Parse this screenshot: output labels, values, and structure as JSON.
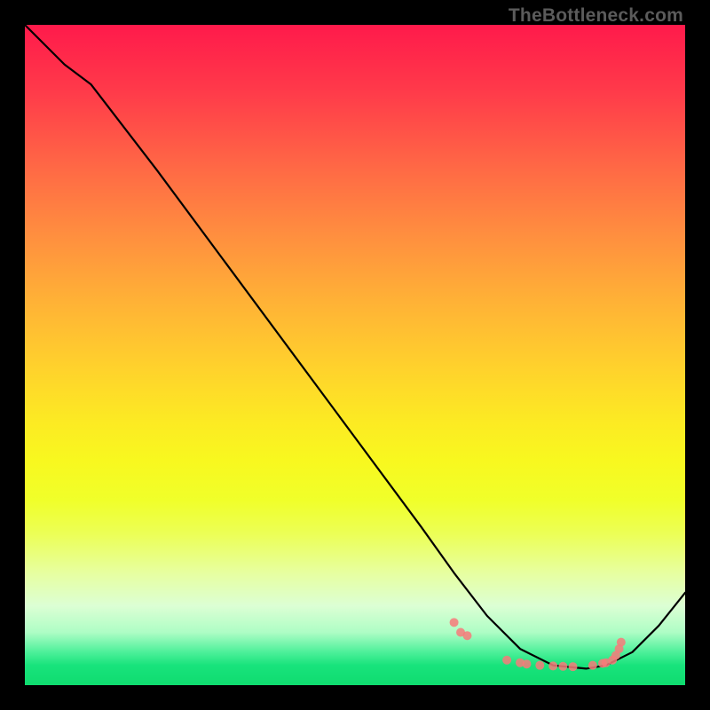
{
  "watermark": "TheBottleneck.com",
  "colors": {
    "background": "#000000",
    "curve": "#000000",
    "marker": "#f77a7a",
    "gradient_top": "#ff1a4b",
    "gradient_bottom": "#0fdc6f"
  },
  "chart_data": {
    "type": "line",
    "title": "",
    "xlabel": "",
    "ylabel": "",
    "xlim": [
      0,
      100
    ],
    "ylim": [
      0,
      100
    ],
    "grid": false,
    "legend": false,
    "series": [
      {
        "name": "curve",
        "x": [
          0,
          6,
          10,
          20,
          30,
          40,
          50,
          60,
          65,
          70,
          75,
          80,
          85,
          88,
          92,
          96,
          100
        ],
        "y": [
          100,
          94,
          91,
          78,
          64.5,
          51,
          37.5,
          24,
          17,
          10.5,
          5.5,
          3,
          2.5,
          3,
          5,
          9,
          14
        ],
        "notes": "Values are percentages of the plot area. y=100 is the top edge of the colored square, y=0 is the bottom. The curve falls roughly linearly from the top-left corner, flattens near the bottom around x≈80–85, then rises toward the right edge."
      }
    ],
    "markers": {
      "name": "scatter-points",
      "color": "#f77a7a",
      "radius": 5,
      "points_xy": [
        [
          65,
          9.5
        ],
        [
          66,
          8
        ],
        [
          67,
          7.5
        ],
        [
          73,
          3.8
        ],
        [
          75,
          3.4
        ],
        [
          76,
          3.2
        ],
        [
          78,
          3.0
        ],
        [
          80,
          2.9
        ],
        [
          81.5,
          2.85
        ],
        [
          83,
          2.8
        ],
        [
          86,
          3.0
        ],
        [
          87.5,
          3.3
        ],
        [
          88,
          3.4
        ],
        [
          89,
          3.8
        ],
        [
          89.5,
          4.5
        ],
        [
          90,
          5.5
        ],
        [
          90.3,
          6.5
        ]
      ]
    }
  }
}
